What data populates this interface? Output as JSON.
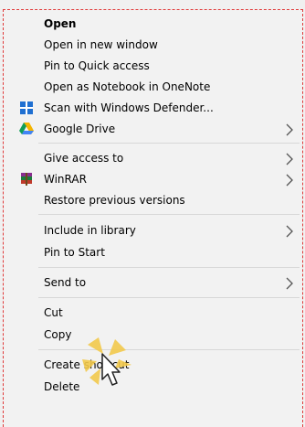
{
  "menu": {
    "items": [
      {
        "label": "Open",
        "bold": true
      },
      {
        "label": "Open in new window"
      },
      {
        "label": "Pin to Quick access"
      },
      {
        "label": "Open as Notebook in OneNote"
      },
      {
        "label": "Scan with Windows Defender...",
        "icon": "windows-defender-icon"
      },
      {
        "label": "Google Drive",
        "icon": "google-drive-icon",
        "submenu": true
      },
      {
        "label": "Give access to",
        "submenu": true
      },
      {
        "label": "WinRAR",
        "icon": "winrar-icon",
        "submenu": true
      },
      {
        "label": "Restore previous versions"
      },
      {
        "label": "Include in library",
        "submenu": true
      },
      {
        "label": "Pin to Start"
      },
      {
        "label": "Send to",
        "submenu": true
      },
      {
        "label": "Cut"
      },
      {
        "label": "Copy"
      },
      {
        "label": "Create shortcut"
      },
      {
        "label": "Delete"
      }
    ]
  },
  "colors": {
    "menu_background": "#f2f2f2",
    "border": "#e03a3a",
    "separator": "#d7d7d7",
    "defender_blue": "#1f6fd1",
    "drive_yellow": "#f4b400",
    "drive_green": "#0f9d58",
    "drive_blue": "#4285f4"
  },
  "cursor": {
    "icon": "hand-pointer-click-icon"
  }
}
